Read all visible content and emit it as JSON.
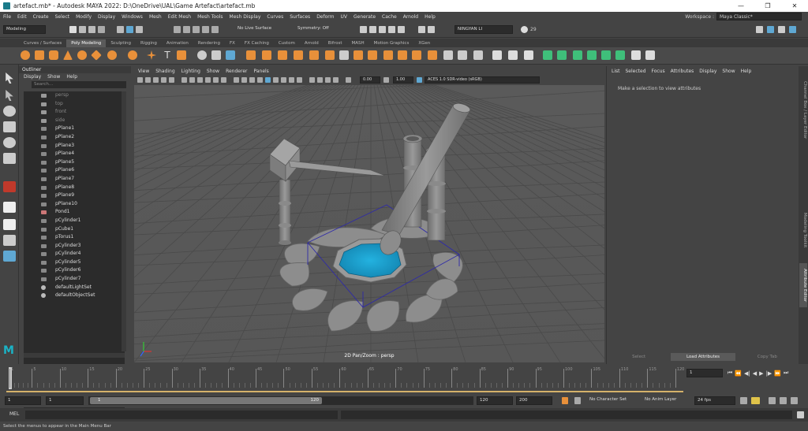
{
  "window": {
    "title": "artefact.mb* - Autodesk MAYA 2022: D:\\OneDrive\\UAL\\Game Artefact\\artefact.mb",
    "minimize": "—",
    "maximize": "❐",
    "close": "✕"
  },
  "menubar": {
    "items": [
      "File",
      "Edit",
      "Create",
      "Select",
      "Modify",
      "Display",
      "Windows",
      "Mesh",
      "Edit Mesh",
      "Mesh Tools",
      "Mesh Display",
      "Curves",
      "Surfaces",
      "Deform",
      "UV",
      "Generate",
      "Cache",
      "Arnold",
      "Help"
    ],
    "workspace_label": "Workspace :",
    "workspace_value": "Maya Classic*"
  },
  "statusline": {
    "menuset": "Modeling",
    "live_surface": "No Live Surface",
    "symmetry": "Symmetry: Off",
    "user": "NINGYAN LI",
    "count": "29"
  },
  "shelf": {
    "tabs": [
      "Curves / Surfaces",
      "Poly Modeling",
      "Sculpting",
      "Rigging",
      "Animation",
      "Rendering",
      "FX",
      "FX Caching",
      "Custom",
      "Arnold",
      "Bifrost",
      "MASH",
      "Motion Graphics",
      "XGen"
    ],
    "active_tab": "Poly Modeling"
  },
  "outliner": {
    "title": "Outliner",
    "menu": [
      "Display",
      "Show",
      "Help"
    ],
    "search_placeholder": "Search...",
    "items": [
      {
        "name": "persp",
        "type": "camera"
      },
      {
        "name": "top",
        "type": "camera"
      },
      {
        "name": "front",
        "type": "camera"
      },
      {
        "name": "side",
        "type": "camera"
      },
      {
        "name": "pPlane1",
        "type": "mesh"
      },
      {
        "name": "pPlane2",
        "type": "mesh"
      },
      {
        "name": "pPlane3",
        "type": "mesh"
      },
      {
        "name": "pPlane4",
        "type": "mesh"
      },
      {
        "name": "pPlane5",
        "type": "mesh"
      },
      {
        "name": "pPlane6",
        "type": "mesh"
      },
      {
        "name": "pPlane7",
        "type": "mesh"
      },
      {
        "name": "pPlane8",
        "type": "mesh"
      },
      {
        "name": "pPlane9",
        "type": "mesh"
      },
      {
        "name": "pPlane10",
        "type": "mesh"
      },
      {
        "name": "Pond1",
        "type": "group"
      },
      {
        "name": "pCylinder1",
        "type": "mesh"
      },
      {
        "name": "pCube1",
        "type": "mesh"
      },
      {
        "name": "pTorus1",
        "type": "mesh"
      },
      {
        "name": "pCylinder3",
        "type": "mesh"
      },
      {
        "name": "pCylinder4",
        "type": "mesh"
      },
      {
        "name": "pCylinder5",
        "type": "mesh"
      },
      {
        "name": "pCylinder6",
        "type": "mesh"
      },
      {
        "name": "pCylinder7",
        "type": "mesh"
      },
      {
        "name": "defaultLightSet",
        "type": "set"
      },
      {
        "name": "defaultObjectSet",
        "type": "set"
      }
    ]
  },
  "viewport": {
    "menu": [
      "View",
      "Shading",
      "Lighting",
      "Show",
      "Renderer",
      "Panels"
    ],
    "exposure": "0.00",
    "gamma": "1.00",
    "colorspace": "ACES 1.0 SDR-video (sRGB)",
    "label": "2D Pan/Zoom : persp",
    "colors": {
      "water": "#1a9fcc",
      "model": "#8a8a8a",
      "grid": "#4c4c4c",
      "background": "#595959"
    }
  },
  "attribute_editor": {
    "menu": [
      "List",
      "Selected",
      "Focus",
      "Attributes",
      "Display",
      "Show",
      "Help"
    ],
    "message": "Make a selection to view attributes",
    "buttons": [
      "Select",
      "Load Attributes",
      "Copy Tab"
    ],
    "side_tabs": [
      "Channel Box / Layer Editor",
      "Modeling Toolkit",
      "Attribute Editor"
    ]
  },
  "timeline": {
    "ticks": [
      "1",
      "5",
      "10",
      "15",
      "20",
      "25",
      "30",
      "35",
      "40",
      "45",
      "50",
      "55",
      "60",
      "65",
      "70",
      "75",
      "80",
      "85",
      "90",
      "95",
      "100",
      "105",
      "110",
      "115",
      "120"
    ],
    "current_frame": "1"
  },
  "range": {
    "start": "1",
    "inner_start": "1",
    "slider_start": "1",
    "slider_end": "120",
    "inner_end": "120",
    "end": "200",
    "character_set": "No Character Set",
    "anim_layer": "No Anim Layer",
    "fps": "24 fps"
  },
  "cmdline": {
    "label": "MEL"
  },
  "helpline": {
    "text": "Select the menus to appear in the Main Menu Bar"
  }
}
